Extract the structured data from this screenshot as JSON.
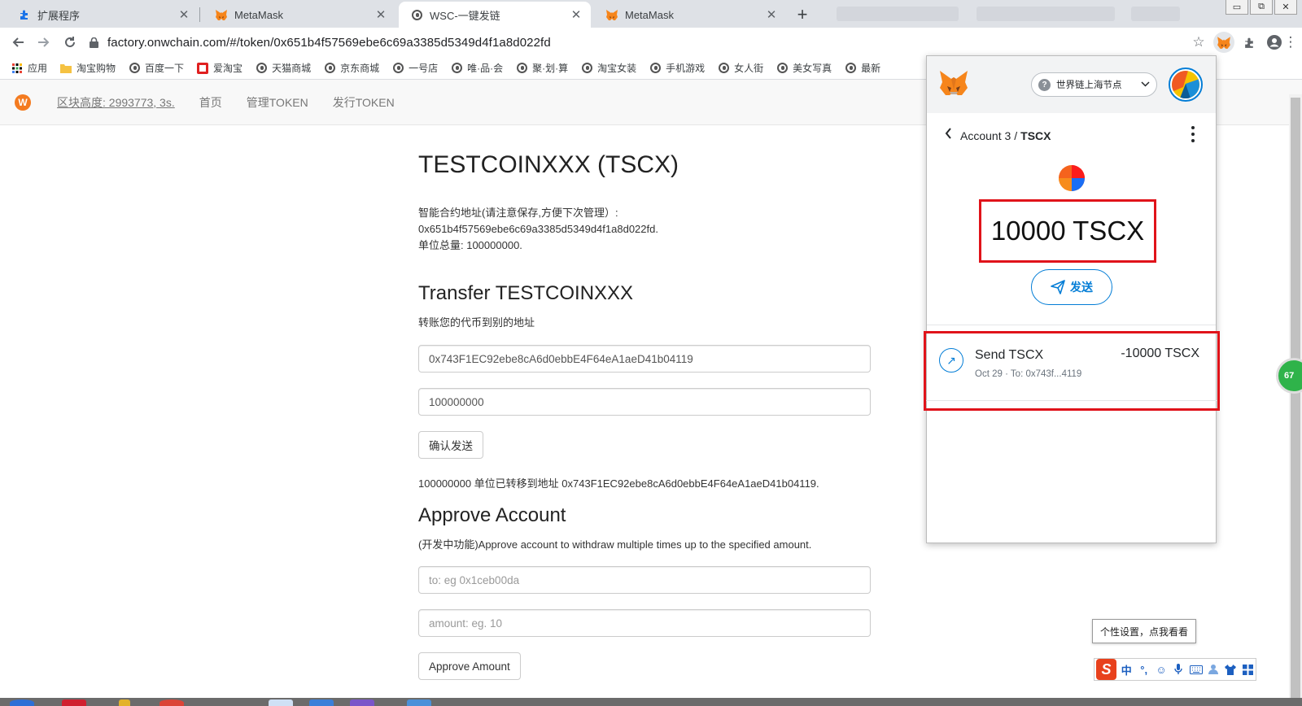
{
  "browser": {
    "tabs": [
      {
        "title": "扩展程序",
        "icon": "puzzle-icon"
      },
      {
        "title": "MetaMask",
        "icon": "metamask-fox-icon"
      },
      {
        "title": "WSC-一键发链",
        "icon": "globe-icon"
      },
      {
        "title": "MetaMask",
        "icon": "metamask-fox-icon"
      }
    ],
    "url": "factory.onwchain.com/#/token/0x651b4f57569ebe6c69a3385d5349d4f1a8d022fd",
    "window_buttons": [
      "▭",
      "⧉",
      "✕"
    ]
  },
  "bookmarks": [
    {
      "label": "应用",
      "icon": "apps-grid-icon"
    },
    {
      "label": "淘宝购物",
      "icon": "folder-icon"
    },
    {
      "label": "百度一下",
      "icon": "globe-icon"
    },
    {
      "label": "爱淘宝",
      "icon": "aitaobao-icon"
    },
    {
      "label": "天猫商城",
      "icon": "globe-icon"
    },
    {
      "label": "京东商城",
      "icon": "globe-icon"
    },
    {
      "label": "一号店",
      "icon": "globe-icon"
    },
    {
      "label": "唯·品·会",
      "icon": "globe-icon"
    },
    {
      "label": "聚·划·算",
      "icon": "globe-icon"
    },
    {
      "label": "淘宝女装",
      "icon": "globe-icon"
    },
    {
      "label": "手机游戏",
      "icon": "globe-icon"
    },
    {
      "label": "女人街",
      "icon": "globe-icon"
    },
    {
      "label": "美女写真",
      "icon": "globe-icon"
    },
    {
      "label": "最新",
      "icon": "globe-icon"
    }
  ],
  "navbar": {
    "block_height": "区块高度: 2993773, 3s.",
    "links": [
      "首页",
      "管理TOKEN",
      "发行TOKEN"
    ]
  },
  "token": {
    "title": "TESTCOINXXX (TSCX)",
    "contract_label": "智能合约地址(请注意保存,方便下次管理）:",
    "contract_address": "0x651b4f57569ebe6c69a3385d5349d4f1a8d022fd.",
    "supply": "单位总量: 100000000."
  },
  "transfer": {
    "heading": "Transfer TESTCOINXXX",
    "subtitle": "转账您的代币到别的地址",
    "to_value": "0x743F1EC92ebe8cA6d0ebbE4F64eA1aeD41b04119",
    "amount_value": "100000000",
    "confirm_label": "确认发送",
    "result": "100000000 单位已转移到地址 0x743F1EC92ebe8cA6d0ebbE4F64eA1aeD41b04119."
  },
  "approve": {
    "heading": "Approve Account",
    "subtitle": "(开发中功能)Approve account to withdraw multiple times up to the specified amount.",
    "to_placeholder": "to: eg 0x1ceb00da",
    "amount_placeholder": "amount: eg. 10",
    "button_label": "Approve Amount"
  },
  "metamask": {
    "network": "世界链上海节点",
    "account": "Account 3",
    "separator": "/",
    "token": "TSCX",
    "balance": "10000 TSCX",
    "send_label": "发送",
    "transaction": {
      "title": "Send TSCX",
      "date": "Oct 29",
      "to": "To: 0x743f...4119",
      "amount": "-10000 TSCX"
    }
  },
  "overlay": {
    "green_badge": "67",
    "ime_tip": "个性设置，点我看看",
    "ime_mode": "中"
  },
  "colors": {
    "highlight_red": "#e0131a",
    "metamask_blue": "#037dd6",
    "metamask_orange": "#f6851b"
  }
}
